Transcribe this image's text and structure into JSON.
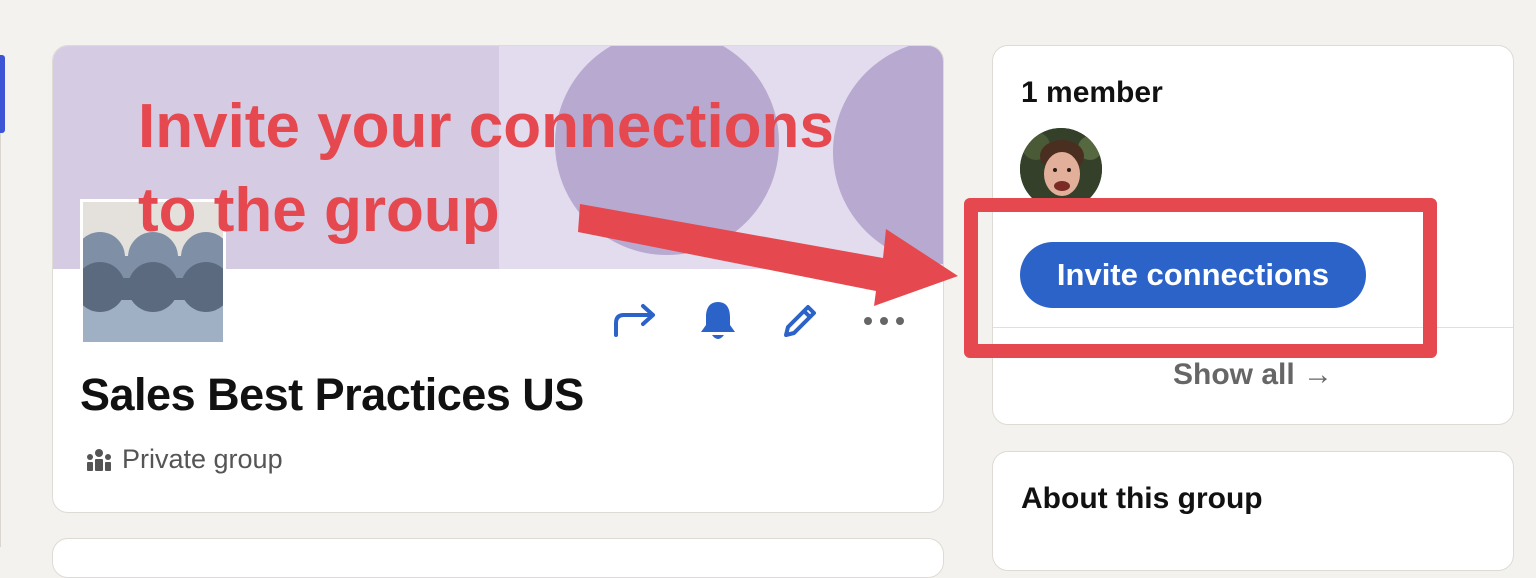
{
  "group": {
    "title": "Sales Best Practices US",
    "privacy_label": "Private group",
    "actions": [
      {
        "name": "share-icon",
        "label": "Share"
      },
      {
        "name": "bell-icon",
        "label": "Notifications"
      },
      {
        "name": "pencil-icon",
        "label": "Edit"
      },
      {
        "name": "more-icon",
        "label": "More"
      }
    ]
  },
  "members": {
    "count_label": "1 member",
    "invite_label": "Invite connections",
    "show_all_label": "Show all →"
  },
  "about": {
    "title": "About this group"
  },
  "annotation": {
    "line1": "Invite your connections",
    "line2": "to the group"
  },
  "colors": {
    "accent_blue": "#2c63c9",
    "annotation_red": "#e5484e",
    "cover_lavender": "#d5cbe3",
    "page_background": "#f4f2ee"
  }
}
